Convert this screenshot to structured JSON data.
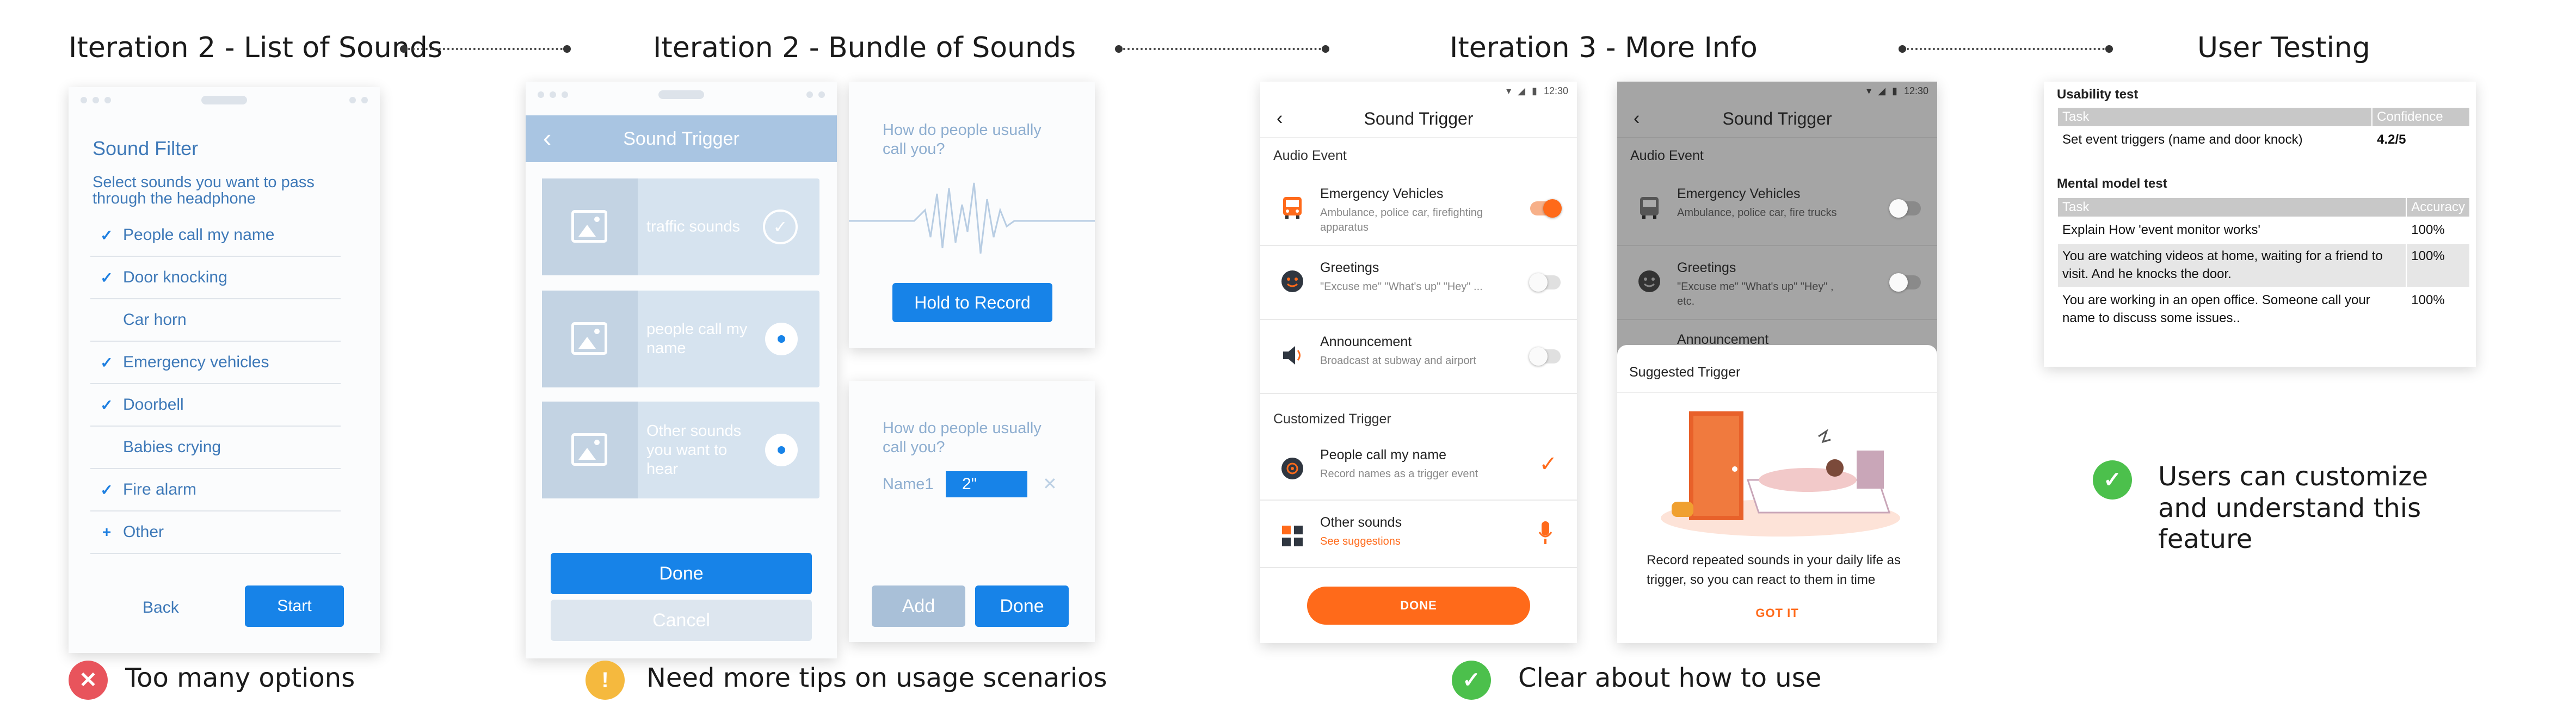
{
  "sections": {
    "iter2_list": "Iteration 2 - List of Sounds",
    "iter2_bundle": "Iteration 2 - Bundle of Sounds",
    "iter3": "Iteration 3 - More Info",
    "user_testing": "User Testing"
  },
  "feedback": {
    "too_many": "Too many options",
    "need_tips": "Need more tips on usage scenarios",
    "clear": "Clear about how to use",
    "customize": "Users can customize and understand this feature"
  },
  "sound_filter": {
    "title": "Sound Filter",
    "description": "Select sounds you want to pass through the headphone",
    "items": [
      {
        "label": "People call my name",
        "checked": true
      },
      {
        "label": "Door knocking",
        "checked": true
      },
      {
        "label": "Car horn",
        "checked": false
      },
      {
        "label": "Emergency vehicles",
        "checked": true
      },
      {
        "label": "Doorbell",
        "checked": true
      },
      {
        "label": "Babies crying",
        "checked": false
      },
      {
        "label": "Fire alarm",
        "checked": true
      },
      {
        "label": "Other",
        "checked": false
      }
    ],
    "add_glyph": "+",
    "back": "Back",
    "start": "Start"
  },
  "bundle": {
    "title": "Sound Trigger",
    "cards": [
      "traffic sounds",
      "people call my name",
      "Other sounds you want to hear"
    ],
    "done": "Done",
    "cancel": "Cancel"
  },
  "record": {
    "question": "How do people usually call you?",
    "hold_to_record": "Hold to Record"
  },
  "name_entry": {
    "question": "How do people usually call you?",
    "name_label": "Name1",
    "name_value": "2\"",
    "add": "Add",
    "done": "Done"
  },
  "trigger_screen": {
    "time": "12:30",
    "title": "Sound Trigger",
    "audio_event": "Audio Event",
    "rows": [
      {
        "title": "Emergency Vehicles",
        "sub": "Ambulance, police car, firefighting apparatus",
        "on": true
      },
      {
        "title": "Greetings",
        "sub": "\"Excuse me\" \"What's up\" \"Hey\" ...",
        "on": false
      },
      {
        "title": "Announcement",
        "sub": "Broadcast at subway and airport",
        "on": false
      }
    ],
    "customized": "Customized Trigger",
    "custom_rows": [
      {
        "title": "People call my name",
        "sub": "Record names as a trigger event"
      },
      {
        "title": "Other sounds",
        "sub": "See suggestions"
      }
    ],
    "done": "DONE"
  },
  "overlay_screen": {
    "time": "12:30",
    "title": "Sound Trigger",
    "audio_event": "Audio Event",
    "rows": [
      {
        "title": "Emergency Vehicles",
        "sub": "Ambulance, police car, fire trucks"
      },
      {
        "title": "Greetings",
        "sub": "\"Excuse me\" \"What's up\" \"Hey\" , etc."
      },
      {
        "title": "Announcement",
        "sub": ""
      }
    ],
    "suggested": "Suggested Trigger",
    "suggestion_text": "Record repeated sounds in your daily life as trigger, so you can react to them in time",
    "got_it": "GOT IT"
  },
  "testing": {
    "usability_title": "Usability test",
    "usability_headers": [
      "Task",
      "Confidence"
    ],
    "usability_rows": [
      [
        "Set event triggers (name and door knock)",
        "4.2/5"
      ]
    ],
    "mental_title": "Mental model test",
    "mental_headers": [
      "Task",
      "Accuracy"
    ],
    "mental_rows": [
      [
        "Explain How 'event monitor works'",
        "100%"
      ],
      [
        "You are watching videos at home, waiting for a friend to visit. And he knocks the door.",
        "100%"
      ],
      [
        "You are working in an open office. Someone call your name to discuss some issues..",
        "100%"
      ]
    ]
  },
  "colors": {
    "accent_blue": "#1783e8",
    "accent_orange": "#ff6a1a",
    "error_red": "#e8545c",
    "warn_yellow": "#f5b93e",
    "ok_green": "#4cc04c"
  }
}
